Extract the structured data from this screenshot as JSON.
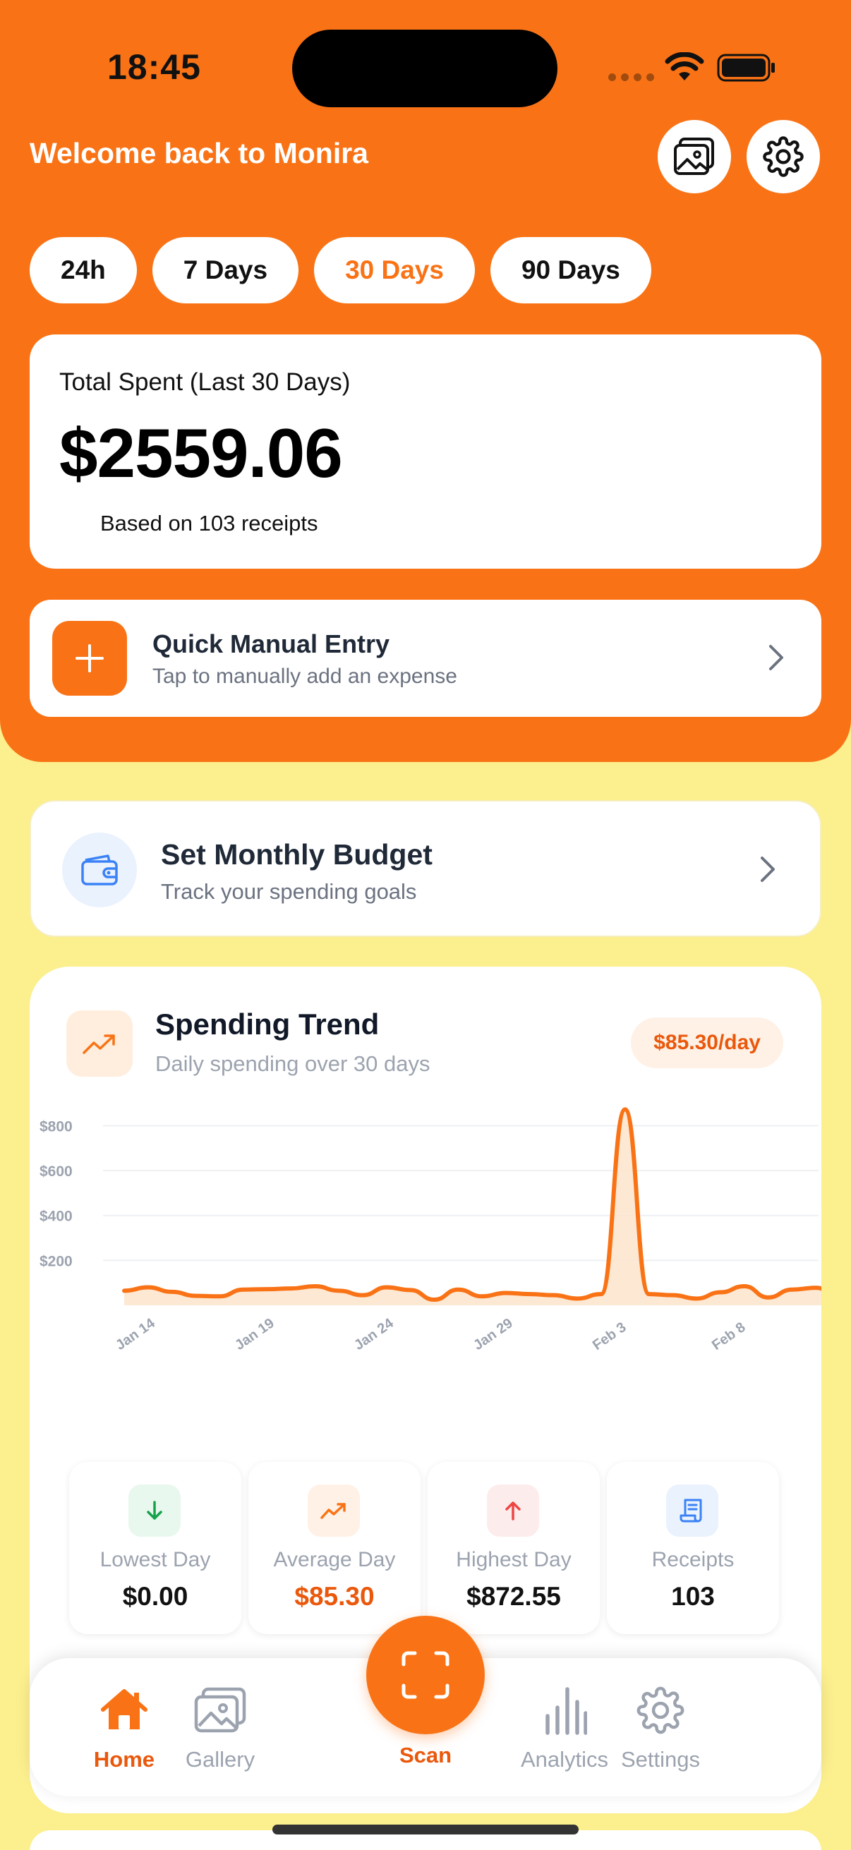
{
  "status_bar": {
    "time": "18:45"
  },
  "header": {
    "welcome": "Welcome back to Monira",
    "gallery_icon": "image-gallery-icon",
    "settings_icon": "gear-icon"
  },
  "period_tabs": [
    {
      "label": "24h",
      "active": false
    },
    {
      "label": "7 Days",
      "active": false
    },
    {
      "label": "30 Days",
      "active": true
    },
    {
      "label": "90 Days",
      "active": false
    }
  ],
  "total": {
    "label": "Total Spent (Last 30 Days)",
    "amount": "$2559.06",
    "based_on": "Based on 103 receipts"
  },
  "quick_entry": {
    "title": "Quick Manual Entry",
    "subtitle": "Tap to manually add an expense"
  },
  "budget": {
    "title": "Set Monthly Budget",
    "subtitle": "Track your spending goals"
  },
  "trend": {
    "title": "Spending Trend",
    "subtitle": "Daily spending over 30 days",
    "per_day": "$85.30/day"
  },
  "chart_data": {
    "type": "area",
    "title": "",
    "y_ticks": [
      "$800",
      "$600",
      "$400",
      "$200"
    ],
    "x_ticks": [
      "Jan 14",
      "Jan 19",
      "Jan 24",
      "Jan 29",
      "Feb 3",
      "Feb 8"
    ],
    "ylim": [
      0,
      880
    ],
    "x_start": "2025-01-13",
    "x_end": "2025-02-12",
    "series": [
      {
        "color": "#F97316",
        "points": [
          [
            "2025-01-13",
            65
          ],
          [
            "2025-01-14",
            80
          ],
          [
            "2025-01-15",
            60
          ],
          [
            "2025-01-16",
            42
          ],
          [
            "2025-01-17",
            40
          ],
          [
            "2025-01-18",
            70
          ],
          [
            "2025-01-19",
            72
          ],
          [
            "2025-01-20",
            75
          ],
          [
            "2025-01-21",
            85
          ],
          [
            "2025-01-22",
            65
          ],
          [
            "2025-01-23",
            45
          ],
          [
            "2025-01-24",
            80
          ],
          [
            "2025-01-25",
            68
          ],
          [
            "2025-01-26",
            25
          ],
          [
            "2025-01-27",
            70
          ],
          [
            "2025-01-28",
            40
          ],
          [
            "2025-01-29",
            55
          ],
          [
            "2025-01-30",
            50
          ],
          [
            "2025-01-31",
            45
          ],
          [
            "2025-02-01",
            30
          ],
          [
            "2025-02-02",
            50
          ],
          [
            "2025-02-03",
            872.55
          ],
          [
            "2025-02-04",
            50
          ],
          [
            "2025-02-05",
            45
          ],
          [
            "2025-02-06",
            30
          ],
          [
            "2025-02-07",
            58
          ],
          [
            "2025-02-08",
            85
          ],
          [
            "2025-02-09",
            35
          ],
          [
            "2025-02-10",
            70
          ],
          [
            "2025-02-11",
            78
          ],
          [
            "2025-02-12",
            40
          ]
        ]
      }
    ]
  },
  "stats": [
    {
      "label": "Lowest Day",
      "value": "$0.00",
      "icon": "arrow-down-icon",
      "color": "#111111",
      "bg": "#E8F8EE",
      "iconColor": "#16A34A"
    },
    {
      "label": "Average Day",
      "value": "$85.30",
      "icon": "trend-up-icon",
      "color": "#EA580C",
      "bg": "#FFF1E6",
      "iconColor": "#F97316"
    },
    {
      "label": "Highest Day",
      "value": "$872.55",
      "icon": "arrow-up-icon",
      "color": "#111111",
      "bg": "#FDECEC",
      "iconColor": "#EF4444"
    },
    {
      "label": "Receipts",
      "value": "103",
      "icon": "receipt-icon",
      "color": "#111111",
      "bg": "#EAF2FE",
      "iconColor": "#3B82F6"
    }
  ],
  "tab_bar": {
    "items": [
      {
        "label": "Home",
        "icon": "home-icon",
        "active": true
      },
      {
        "label": "Gallery",
        "icon": "image-gallery-icon",
        "active": false
      },
      {
        "label": "Analytics",
        "icon": "bar-chart-icon",
        "active": false
      },
      {
        "label": "Settings",
        "icon": "gear-icon",
        "active": false
      }
    ],
    "scan_label": "Scan",
    "scan_icon": "scan-frame-icon"
  },
  "colors": {
    "accent": "#F97316",
    "background": "#FCEF8E"
  }
}
